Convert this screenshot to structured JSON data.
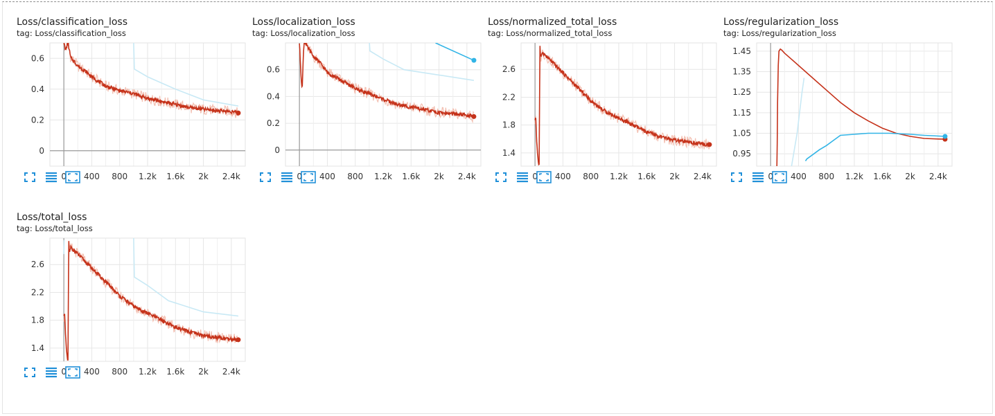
{
  "icons": {
    "expand": "expand-icon",
    "log_scale": "list-icon",
    "fit_domain": "fit-domain-icon"
  },
  "colors": {
    "run_red": "#c5321a",
    "run_red_raw": "#f2b8a8",
    "run_blue": "#31b4e6",
    "run_blue_raw": "#c8e9f5",
    "grid": "#e6e6e6",
    "axis": "#9a9a9a"
  },
  "cards": [
    {
      "title": "Loss/classification_loss",
      "tag": "tag: Loss/classification_loss",
      "chart_data": {
        "type": "line",
        "xlim": [
          -200,
          2600
        ],
        "ylim": [
          -0.1,
          0.7
        ],
        "x_ticks": [
          0,
          400,
          800,
          1200,
          1600,
          2000,
          2400
        ],
        "x_tick_labels": [
          "0",
          "400",
          "800",
          "1.2k",
          "1.6k",
          "2k",
          "2.4k"
        ],
        "y_ticks": [
          0,
          0.2,
          0.4,
          0.6
        ],
        "y_tick_labels": [
          "0",
          "0.2",
          "0.4",
          "0.6"
        ],
        "series": [
          {
            "color": "#c5321a",
            "raw": true,
            "end_marker": true,
            "x": [
              0,
              20,
              60,
              100,
              150,
              200,
              300,
              400,
              500,
              600,
              800,
              1000,
              1200,
              1400,
              1600,
              1800,
              2000,
              2200,
              2400,
              2500
            ],
            "y": [
              0.72,
              0.65,
              0.7,
              0.6,
              0.58,
              0.55,
              0.52,
              0.48,
              0.45,
              0.42,
              0.39,
              0.37,
              0.34,
              0.32,
              0.3,
              0.28,
              0.27,
              0.26,
              0.255,
              0.245
            ]
          },
          {
            "color": "#c8e9f5",
            "x": [
              1000,
              1010,
              1200,
              1600,
              2000,
              2500
            ],
            "y": [
              0.7,
              0.53,
              0.48,
              0.4,
              0.33,
              0.29
            ]
          }
        ]
      }
    },
    {
      "title": "Loss/localization_loss",
      "tag": "tag: Loss/localization_loss",
      "chart_data": {
        "type": "line",
        "xlim": [
          -200,
          2600
        ],
        "ylim": [
          -0.12,
          0.8
        ],
        "x_ticks": [
          0,
          400,
          800,
          1200,
          1600,
          2000,
          2400
        ],
        "x_tick_labels": [
          "0",
          "400",
          "800",
          "1.2k",
          "1.6k",
          "2k",
          "2.4k"
        ],
        "y_ticks": [
          0,
          0.2,
          0.4,
          0.6
        ],
        "y_tick_labels": [
          "0",
          "0.2",
          "0.4",
          "0.6"
        ],
        "series": [
          {
            "color": "#c5321a",
            "raw": true,
            "end_marker": true,
            "x": [
              0,
              25,
              40,
              55,
              70,
              100,
              150,
              200,
              300,
              400,
              600,
              800,
              1000,
              1200,
              1400,
              1600,
              1800,
              2000,
              2200,
              2400,
              2500
            ],
            "y": [
              0.8,
              0.55,
              0.44,
              0.7,
              0.82,
              0.78,
              0.74,
              0.7,
              0.65,
              0.58,
              0.52,
              0.46,
              0.42,
              0.38,
              0.34,
              0.32,
              0.3,
              0.28,
              0.27,
              0.26,
              0.25
            ]
          },
          {
            "color": "#c8e9f5",
            "x": [
              1000,
              1010,
              1200,
              1500,
              2000,
              2500
            ],
            "y": [
              0.82,
              0.74,
              0.68,
              0.6,
              0.56,
              0.52
            ]
          },
          {
            "color": "#31b4e6",
            "end_marker": true,
            "x": [
              1950,
              2500
            ],
            "y": [
              0.8,
              0.67
            ]
          }
        ]
      }
    },
    {
      "title": "Loss/normalized_total_loss",
      "tag": "tag: Loss/normalized_total_loss",
      "chart_data": {
        "type": "line",
        "xlim": [
          -200,
          2600
        ],
        "ylim": [
          1.21,
          2.98
        ],
        "x_ticks": [
          0,
          400,
          800,
          1200,
          1600,
          2000,
          2400
        ],
        "x_tick_labels": [
          "0",
          "400",
          "800",
          "1.2k",
          "1.6k",
          "2k",
          "2.4k"
        ],
        "y_ticks": [
          1.4,
          1.8,
          2.2,
          2.6
        ],
        "y_tick_labels": [
          "1.4",
          "1.8",
          "2.2",
          "2.6"
        ],
        "series": [
          {
            "color": "#c5321a",
            "raw": true,
            "end_marker": true,
            "x": [
              0,
              10,
              25,
              40,
              50,
              60,
              70,
              80,
              100,
              150,
              200,
              300,
              400,
              500,
              600,
              800,
              1000,
              1200,
              1400,
              1600,
              1800,
              2000,
              2200,
              2400,
              2500
            ],
            "y": [
              1.85,
              1.95,
              1.55,
              1.35,
              1.25,
              1.22,
              2.95,
              2.75,
              2.85,
              2.8,
              2.75,
              2.65,
              2.55,
              2.45,
              2.35,
              2.15,
              2.0,
              1.9,
              1.8,
              1.7,
              1.63,
              1.58,
              1.55,
              1.53,
              1.52
            ]
          }
        ]
      }
    },
    {
      "title": "Loss/regularization_loss",
      "tag": "tag: Loss/regularization_loss",
      "chart_data": {
        "type": "line",
        "xlim": [
          -200,
          2600
        ],
        "ylim": [
          0.89,
          1.49
        ],
        "x_ticks": [
          0,
          400,
          800,
          1200,
          1600,
          2000,
          2400
        ],
        "x_tick_labels": [
          "0",
          "400",
          "800",
          "1.2k",
          "1.6k",
          "2k",
          "2.4k"
        ],
        "y_ticks": [
          0.95,
          1.05,
          1.15,
          1.25,
          1.35,
          1.45
        ],
        "y_tick_labels": [
          "0.95",
          "1.05",
          "1.15",
          "1.25",
          "1.35",
          "1.45"
        ],
        "series": [
          {
            "color": "#c5321a",
            "end_marker": true,
            "x": [
              90,
              95,
              100,
              110,
              120,
              140,
              160,
              200,
              300,
              500,
              800,
              1000,
              1200,
              1400,
              1600,
              1800,
              2000,
              2200,
              2400,
              2500
            ],
            "y": [
              0.89,
              1.0,
              1.2,
              1.38,
              1.45,
              1.46,
              1.455,
              1.44,
              1.41,
              1.35,
              1.26,
              1.2,
              1.15,
              1.11,
              1.075,
              1.05,
              1.035,
              1.025,
              1.022,
              1.021
            ]
          },
          {
            "color": "#c8e9f5",
            "x": [
              300,
              380,
              450,
              480
            ],
            "y": [
              0.89,
              1.05,
              1.25,
              1.32
            ]
          },
          {
            "color": "#31b4e6",
            "end_marker": true,
            "x": [
              500,
              520,
              600,
              700,
              800,
              900,
              1000,
              1400,
              1700,
              2000,
              2200,
              2500
            ],
            "y": [
              0.915,
              0.925,
              0.945,
              0.97,
              0.99,
              1.015,
              1.04,
              1.05,
              1.05,
              1.045,
              1.04,
              1.035
            ]
          }
        ]
      }
    },
    {
      "title": "Loss/total_loss",
      "tag": "tag: Loss/total_loss",
      "chart_data": {
        "type": "line",
        "xlim": [
          -200,
          2600
        ],
        "ylim": [
          1.21,
          2.98
        ],
        "x_ticks": [
          0,
          400,
          800,
          1200,
          1600,
          2000,
          2400
        ],
        "x_tick_labels": [
          "0",
          "400",
          "800",
          "1.2k",
          "1.6k",
          "2k",
          "2.4k"
        ],
        "y_ticks": [
          1.4,
          1.8,
          2.2,
          2.6
        ],
        "y_tick_labels": [
          "1.4",
          "1.8",
          "2.2",
          "2.6"
        ],
        "series": [
          {
            "color": "#c5321a",
            "raw": true,
            "end_marker": true,
            "x": [
              0,
              10,
              25,
              40,
              50,
              60,
              70,
              80,
              100,
              150,
              200,
              300,
              400,
              500,
              600,
              800,
              1000,
              1200,
              1400,
              1600,
              1800,
              2000,
              2200,
              2400,
              2500
            ],
            "y": [
              1.85,
              1.95,
              1.55,
              1.35,
              1.25,
              1.22,
              2.95,
              2.75,
              2.85,
              2.8,
              2.75,
              2.65,
              2.55,
              2.45,
              2.35,
              2.15,
              2.0,
              1.9,
              1.8,
              1.7,
              1.63,
              1.58,
              1.55,
              1.53,
              1.52
            ]
          },
          {
            "color": "#c8e9f5",
            "x": [
              0,
              5
            ],
            "y": [
              2.75,
              2.95
            ]
          },
          {
            "color": "#c8e9f5",
            "x": [
              1000,
              1010,
              1200,
              1500,
              2000,
              2500
            ],
            "y": [
              2.98,
              2.42,
              2.3,
              2.08,
              1.92,
              1.86
            ]
          }
        ]
      }
    }
  ]
}
